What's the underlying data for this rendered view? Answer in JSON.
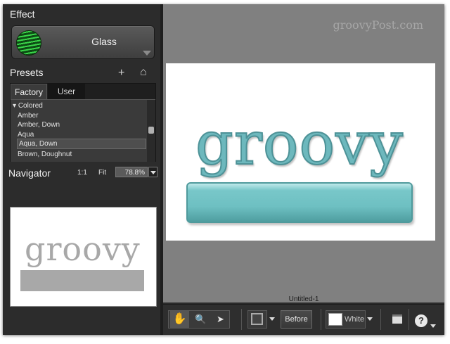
{
  "effect": {
    "title": "Effect",
    "name": "Glass"
  },
  "presets": {
    "title": "Presets",
    "add_icon": "+",
    "home_icon": "⌂",
    "tabs": [
      {
        "label": "Factory"
      },
      {
        "label": "User"
      }
    ],
    "group": "Colored",
    "items": [
      "Amber",
      "Amber, Down",
      "Aqua",
      "Aqua, Down",
      "Brown, Doughnut"
    ],
    "selected": "Aqua, Down"
  },
  "navigator": {
    "title": "Navigator",
    "one_to_one": "1:1",
    "fit": "Fit",
    "zoom": "78.8%",
    "preview_text": "groovy"
  },
  "canvas": {
    "watermark": "groovyPost.com",
    "document_text": "groovy",
    "document_name": "Untitled-1"
  },
  "toolbar": {
    "hand_icon": "✋",
    "zoom_icon": "🔍",
    "select_icon": "➤",
    "before_label": "Before",
    "background_label": "White",
    "help_icon": "?"
  }
}
